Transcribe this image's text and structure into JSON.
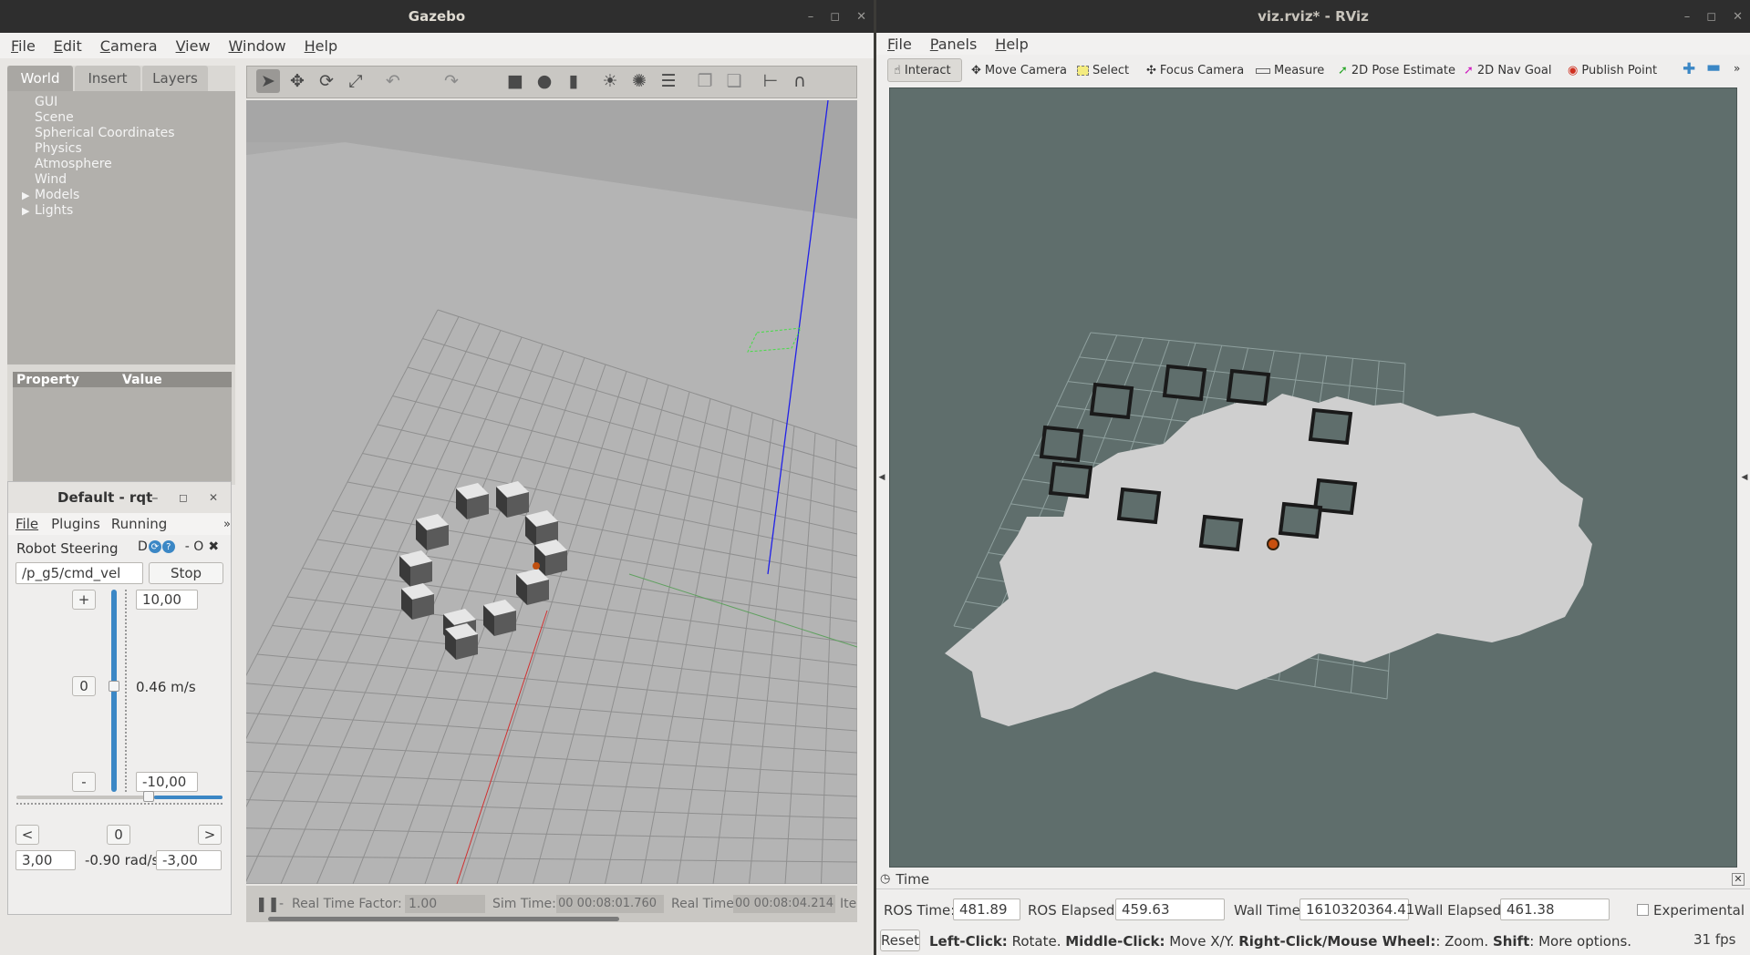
{
  "gazebo": {
    "title": "Gazebo",
    "menu": [
      "File",
      "Edit",
      "Camera",
      "View",
      "Window",
      "Help"
    ],
    "tabs": [
      "World",
      "Insert",
      "Layers"
    ],
    "tree": [
      "GUI",
      "Scene",
      "Spherical Coordinates",
      "Physics",
      "Atmosphere",
      "Wind",
      "Models",
      "Lights"
    ],
    "prop_header": {
      "property": "Property",
      "value": "Value"
    },
    "status": {
      "rtf_label": "Real Time Factor:",
      "rtf_value": "1.00",
      "sim_label": "Sim Time:",
      "sim_value": "00 00:08:01.760",
      "real_label": "Real Time:",
      "real_value": "00 00:08:04.214",
      "iter_label": "Ite"
    }
  },
  "rqt": {
    "title": "Default - rqt",
    "menu": [
      "File",
      "Plugins",
      "Running"
    ],
    "plugin_name": "Robot Steering",
    "plugin_controls": "D",
    "plugin_controls_right": "- O",
    "topic": "/p_g5/cmd_vel",
    "stop_label": "Stop",
    "plus_label": "+",
    "zero_label": "0",
    "minus_label": "-",
    "lin_max": "10,00",
    "lin_min": "-10,00",
    "lin_value": "0.46 m/s",
    "lin_fraction": 0.523,
    "ang_fraction": 0.65,
    "left_label": "<",
    "ang_zero_label": "0",
    "right_label": ">",
    "ang_max": "3,00",
    "ang_min": "-3,00",
    "ang_value": "-0.90 rad/s"
  },
  "rviz": {
    "title": "viz.rviz* - RViz",
    "menu": [
      "File",
      "Panels",
      "Help"
    ],
    "tools": [
      "Interact",
      "Move Camera",
      "Select",
      "Focus Camera",
      "Measure",
      "2D Pose Estimate",
      "2D Nav Goal",
      "Publish Point"
    ],
    "time_panel_title": "Time",
    "ros_time_label": "ROS Time:",
    "ros_time": "481.89",
    "ros_elapsed_label": "ROS Elapsed:",
    "ros_elapsed": "459.63",
    "wall_time_label": "Wall Time:",
    "wall_time": "1610320364.41",
    "wall_elapsed_label": "Wall Elapsed:",
    "wall_elapsed": "461.38",
    "experimental_label": "Experimental",
    "reset_label": "Reset",
    "hint": {
      "b1": "Left-Click:",
      "t1": " Rotate. ",
      "b2": "Middle-Click:",
      "t2": " Move X/Y. ",
      "b3": "Right-Click/Mouse Wheel:",
      "t3": ": Zoom. ",
      "b4": "Shift",
      "t4": ": More options."
    },
    "fps": "31 fps"
  },
  "colors": {
    "rviz_bg": "#5f6e6c",
    "accent": "#3b87c5",
    "gazebo_sky": "#a5a5a5"
  }
}
